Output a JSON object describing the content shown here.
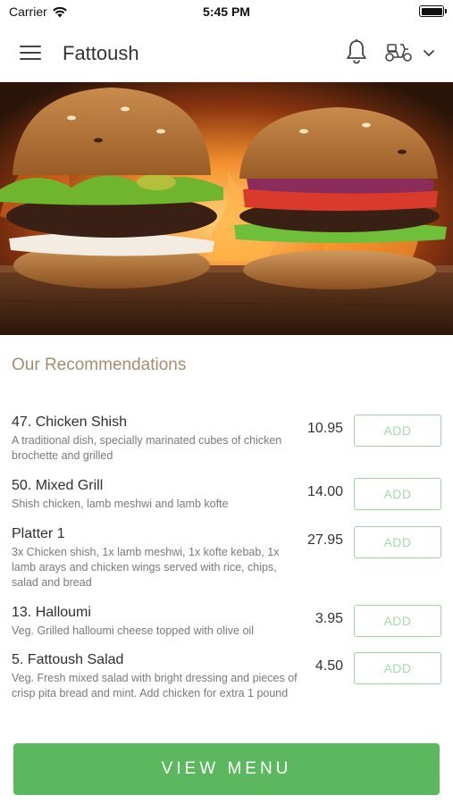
{
  "status_bar": {
    "carrier": "Carrier",
    "time": "5:45 PM"
  },
  "navbar": {
    "title": "Fattoush",
    "icons": [
      "menu-icon",
      "bell-icon",
      "scooter-icon",
      "chevron-down-icon"
    ]
  },
  "hero": {
    "image": "burgers-on-wooden-board-with-fire"
  },
  "recommendations": {
    "title": "Our Recommendations",
    "add_label": "ADD",
    "items": [
      {
        "name": "47. Chicken Shish",
        "description": "A traditional dish, specially marinated cubes of chicken brochette and grilled",
        "price": "10.95"
      },
      {
        "name": "50. Mixed Grill",
        "description": "Shish chicken, lamb meshwi and lamb kofte",
        "price": "14.00"
      },
      {
        "name": "Platter 1",
        "description": "3x Chicken shish, 1x lamb meshwi, 1x kofte kebab, 1x lamb arays and chicken wings served with rice, chips, salad and bread",
        "price": "27.95"
      },
      {
        "name": "13. Halloumi",
        "description": "Veg. Grilled halloumi cheese topped with olive oil",
        "price": "3.95"
      },
      {
        "name": "5. Fattoush Salad",
        "description": "Veg. Fresh mixed salad with bright dressing and pieces of crisp pita bread and mint. Add chicken for extra 1 pound",
        "price": "4.50"
      }
    ]
  },
  "view_menu_label": "VIEW MENU",
  "colors": {
    "accent_green": "#5cb85f",
    "add_border": "#9ed4a3",
    "section_title": "#a38f6f"
  }
}
